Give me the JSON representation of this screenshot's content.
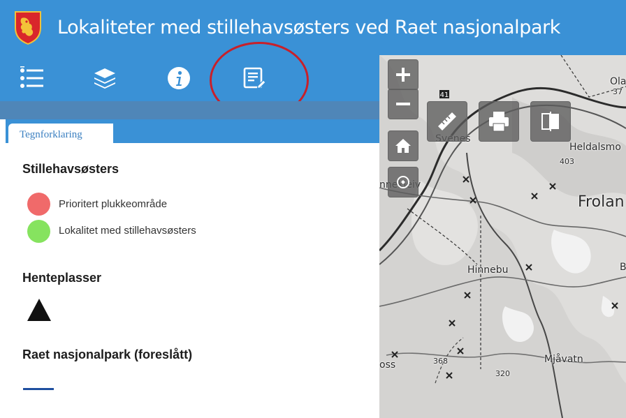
{
  "header": {
    "title": "Lokaliteter med stillehavsøsters ved Raet nasjonalpark",
    "logo_icon": "county-coat-of-arms"
  },
  "toolbar": {
    "tools": [
      {
        "icon": "list-icon"
      },
      {
        "icon": "layers-icon"
      },
      {
        "icon": "info-icon"
      },
      {
        "icon": "edit-document-icon"
      }
    ]
  },
  "panel": {
    "tab_label": "Tegnforklaring",
    "sections": [
      {
        "title": "Stillehavsøsters",
        "items": [
          {
            "label": "Prioritert plukkeområde",
            "color": "#f06a6a"
          },
          {
            "label": "Lokalitet med stillehavsøsters",
            "color": "#86e35f"
          }
        ]
      },
      {
        "title": "Henteplasser",
        "symbol": "black-triangle"
      },
      {
        "title": "Raet nasjonalpark (foreslått)",
        "symbol": "blue-line",
        "color": "#1f4fa0"
      }
    ]
  },
  "map": {
    "labels": [
      "Ola",
      "37",
      "Svenes",
      "Heldalsmo",
      "403",
      "nnekleiv",
      "Frolan",
      "Hinnebu",
      "B",
      "Mjåvatn",
      "oss",
      "368",
      "320"
    ],
    "road_number": "41"
  },
  "colors": {
    "header": "#3a91d6",
    "annotation_circle": "#c8202a"
  }
}
